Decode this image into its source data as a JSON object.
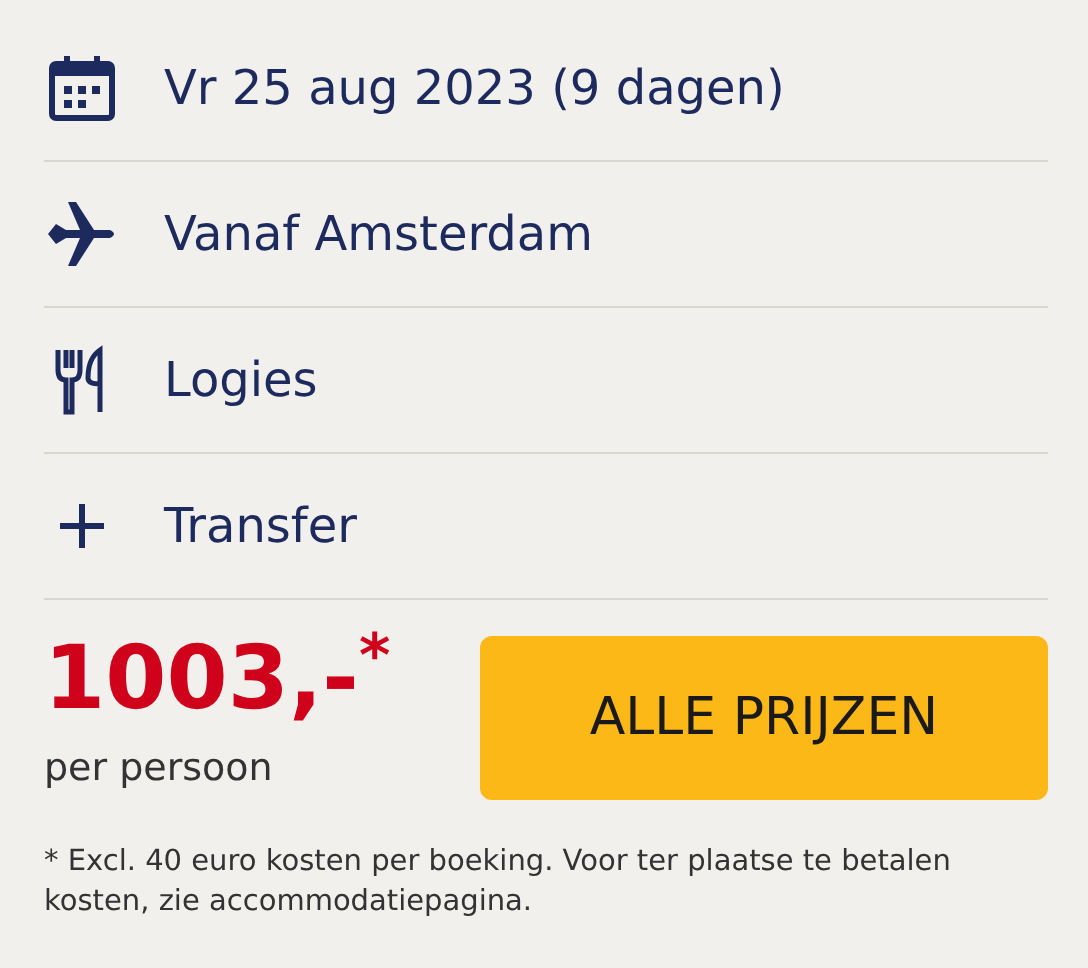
{
  "details": [
    {
      "kind": "calendar",
      "label": "Vr 25 aug 2023 (9 dagen)"
    },
    {
      "kind": "plane",
      "label": "Vanaf Amsterdam"
    },
    {
      "kind": "cutlery",
      "label": "Logies"
    },
    {
      "kind": "plus",
      "label": "Transfer"
    }
  ],
  "price": {
    "amount": "1003,-$^{*}$",
    "unit": "per persoon"
  },
  "button": "ALLE PRIJZEN",
  "footnote": "* Excl. 40 euro kosten per boeking. Voor ter plaatse te betalen kosten, zie accommodatiepagina."
}
